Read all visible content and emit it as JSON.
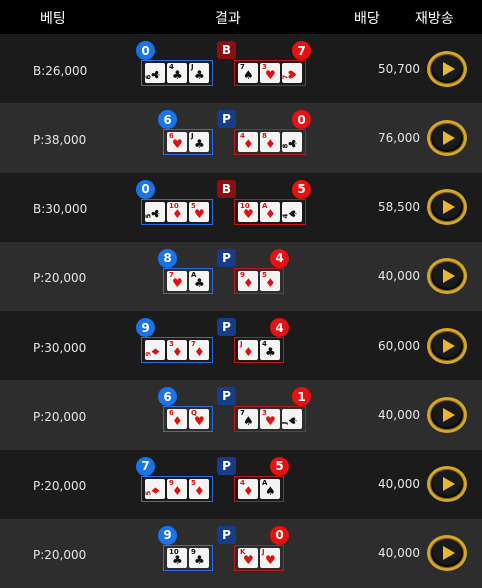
{
  "header": {
    "bet": "베팅",
    "result": "결과",
    "payout": "배당",
    "replay": "재방송"
  },
  "colors": {
    "player": "#1a73e8",
    "banker": "#e81010",
    "gold": "#d4a62a"
  },
  "rows": [
    {
      "bet": "B:26,000",
      "payout": "50,700",
      "winner": "B",
      "player_score": "0",
      "banker_score": "7",
      "player_cards": [
        {
          "rank": "6",
          "suit": "♣",
          "color": "black",
          "side": true
        },
        {
          "rank": "4",
          "suit": "♣",
          "color": "black"
        },
        {
          "rank": "J",
          "suit": "♣",
          "color": "black"
        }
      ],
      "banker_cards": [
        {
          "rank": "7",
          "suit": "♠",
          "color": "black"
        },
        {
          "rank": "3",
          "suit": "♥",
          "color": "red"
        },
        {
          "rank": "7",
          "suit": "♥",
          "color": "red",
          "side": true
        }
      ]
    },
    {
      "bet": "P:38,000",
      "payout": "76,000",
      "winner": "P",
      "player_score": "6",
      "banker_score": "0",
      "player_cards": [
        {
          "rank": "6",
          "suit": "♥",
          "color": "red"
        },
        {
          "rank": "J",
          "suit": "♣",
          "color": "black"
        }
      ],
      "banker_cards": [
        {
          "rank": "4",
          "suit": "♦",
          "color": "red"
        },
        {
          "rank": "8",
          "suit": "♦",
          "color": "red"
        },
        {
          "rank": "8",
          "suit": "♣",
          "color": "black",
          "side": true
        }
      ]
    },
    {
      "bet": "B:30,000",
      "payout": "58,500",
      "winner": "B",
      "player_score": "0",
      "banker_score": "5",
      "player_cards": [
        {
          "rank": "5",
          "suit": "♣",
          "color": "black",
          "side": true
        },
        {
          "rank": "10",
          "suit": "♦",
          "color": "red"
        },
        {
          "rank": "5",
          "suit": "♥",
          "color": "red"
        }
      ],
      "banker_cards": [
        {
          "rank": "10",
          "suit": "♥",
          "color": "red"
        },
        {
          "rank": "A",
          "suit": "♦",
          "color": "red"
        },
        {
          "rank": "4",
          "suit": "♠",
          "color": "black",
          "side": true
        }
      ]
    },
    {
      "bet": "P:20,000",
      "payout": "40,000",
      "winner": "P",
      "player_score": "8",
      "banker_score": "4",
      "player_cards": [
        {
          "rank": "7",
          "suit": "♥",
          "color": "red"
        },
        {
          "rank": "A",
          "suit": "♣",
          "color": "black"
        }
      ],
      "banker_cards": [
        {
          "rank": "9",
          "suit": "♦",
          "color": "red"
        },
        {
          "rank": "5",
          "suit": "♦",
          "color": "red"
        }
      ]
    },
    {
      "bet": "P:30,000",
      "payout": "60,000",
      "winner": "P",
      "player_score": "9",
      "banker_score": "4",
      "player_cards": [
        {
          "rank": "9",
          "suit": "♦",
          "color": "red",
          "side": true
        },
        {
          "rank": "3",
          "suit": "♦",
          "color": "red"
        },
        {
          "rank": "7",
          "suit": "♦",
          "color": "red"
        }
      ],
      "banker_cards": [
        {
          "rank": "J",
          "suit": "♦",
          "color": "red"
        },
        {
          "rank": "4",
          "suit": "♣",
          "color": "black"
        }
      ]
    },
    {
      "bet": "P:20,000",
      "payout": "40,000",
      "winner": "P",
      "player_score": "6",
      "banker_score": "1",
      "player_cards": [
        {
          "rank": "6",
          "suit": "♦",
          "color": "red"
        },
        {
          "rank": "Q",
          "suit": "♥",
          "color": "red"
        }
      ],
      "banker_cards": [
        {
          "rank": "7",
          "suit": "♠",
          "color": "black"
        },
        {
          "rank": "3",
          "suit": "♥",
          "color": "red"
        },
        {
          "rank": "J",
          "suit": "♠",
          "color": "black",
          "side": true
        }
      ]
    },
    {
      "bet": "P:20,000",
      "payout": "40,000",
      "winner": "P",
      "player_score": "7",
      "banker_score": "5",
      "player_cards": [
        {
          "rank": "5",
          "suit": "♦",
          "color": "red",
          "side": true
        },
        {
          "rank": "9",
          "suit": "♦",
          "color": "red"
        },
        {
          "rank": "5",
          "suit": "♦",
          "color": "red"
        }
      ],
      "banker_cards": [
        {
          "rank": "4",
          "suit": "♦",
          "color": "red"
        },
        {
          "rank": "A",
          "suit": "♠",
          "color": "black"
        }
      ]
    },
    {
      "bet": "P:20,000",
      "payout": "40,000",
      "winner": "P",
      "player_score": "9",
      "banker_score": "0",
      "player_cards": [
        {
          "rank": "10",
          "suit": "♣",
          "color": "black"
        },
        {
          "rank": "9",
          "suit": "♣",
          "color": "black"
        }
      ],
      "banker_cards": [
        {
          "rank": "K",
          "suit": "♥",
          "color": "red"
        },
        {
          "rank": "J",
          "suit": "♥",
          "color": "red"
        }
      ]
    }
  ]
}
